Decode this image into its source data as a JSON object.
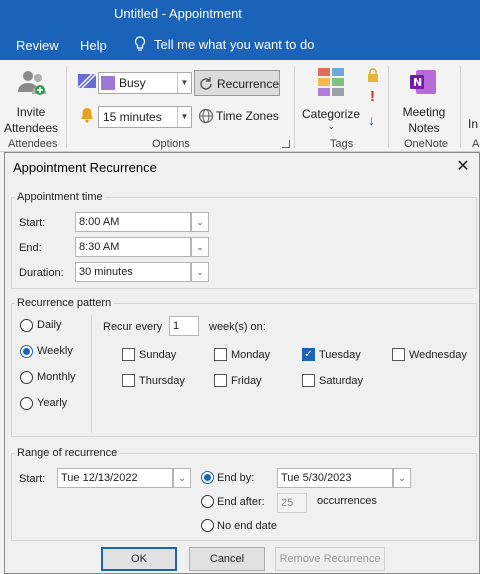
{
  "window": {
    "title": "Untitled  -  Appointment"
  },
  "menubar": {
    "review": "Review",
    "help": "Help",
    "tell_me": "Tell me what you want to do"
  },
  "ribbon": {
    "invite_attendees": "Invite\nAttendees",
    "invite_line1": "Invite",
    "invite_line2": "Attendees",
    "attendees_group": "Attendees",
    "show_as": "Busy",
    "reminder": "15 minutes",
    "recurrence": "Recurrence",
    "time_zones": "Time Zones",
    "options_group": "Options",
    "categorize": "Categorize",
    "tags_group": "Tags",
    "meeting_notes_line1": "Meeting",
    "meeting_notes_line2": "Notes",
    "onenote_group": "OneNote",
    "truncated_1": "In",
    "truncated_2": "A",
    "colors": {
      "busy": "#9b7ad3"
    }
  },
  "dialog": {
    "title": "Appointment Recurrence",
    "appointment_time": {
      "legend": "Appointment time",
      "start_label": "Start:",
      "start_value": "8:00 AM",
      "end_label": "End:",
      "end_value": "8:30 AM",
      "duration_label": "Duration:",
      "duration_value": "30 minutes"
    },
    "recurrence_pattern": {
      "legend": "Recurrence pattern",
      "options": [
        "Daily",
        "Weekly",
        "Monthly",
        "Yearly"
      ],
      "selected": "Weekly",
      "recur_every_label": "Recur every",
      "recur_every_value": "1",
      "weeks_on_label": "week(s) on:",
      "days": {
        "sunday": {
          "label": "Sunday",
          "checked": false
        },
        "monday": {
          "label": "Monday",
          "checked": false
        },
        "tuesday": {
          "label": "Tuesday",
          "checked": true
        },
        "wednesday": {
          "label": "Wednesday",
          "checked": false
        },
        "thursday": {
          "label": "Thursday",
          "checked": false
        },
        "friday": {
          "label": "Friday",
          "checked": false
        },
        "saturday": {
          "label": "Saturday",
          "checked": false
        }
      }
    },
    "range": {
      "legend": "Range of recurrence",
      "start_label": "Start:",
      "start_value": "Tue 12/13/2022",
      "end_by_label": "End by:",
      "end_by_value": "Tue 5/30/2023",
      "end_after_label": "End after:",
      "end_after_value": "25",
      "occurrences_label": "occurrences",
      "no_end_label": "No end date",
      "selected": "End by"
    },
    "buttons": {
      "ok": "OK",
      "cancel": "Cancel",
      "remove": "Remove Recurrence"
    }
  }
}
